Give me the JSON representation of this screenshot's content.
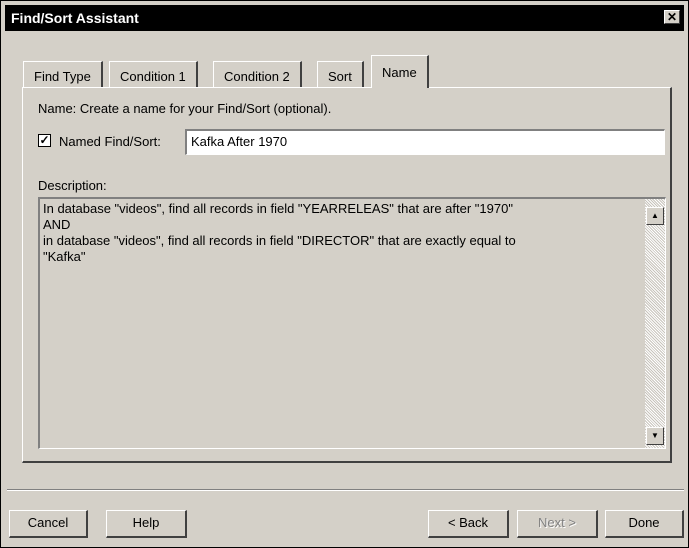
{
  "window": {
    "title": "Find/Sort Assistant",
    "close_glyph": "✕"
  },
  "tabs": [
    {
      "label": "Find Type"
    },
    {
      "label": "Condition 1"
    },
    {
      "label": "Condition 2"
    },
    {
      "label": "Sort"
    },
    {
      "label": "Name",
      "active": true
    }
  ],
  "name_panel": {
    "instruction": "Name: Create a name for your Find/Sort (optional).",
    "named_checkbox_checked": true,
    "checkbox_glyph": "✓",
    "named_label": "Named Find/Sort:",
    "named_value": "Kafka After 1970",
    "description_label": "Description:",
    "description_text": "In database \"videos\", find all records in field \"YEARRELEAS\" that are after \"1970\"\nAND\nin database \"videos\", find all records in field \"DIRECTOR\" that are exactly equal to\n\"Kafka\""
  },
  "buttons": {
    "cancel": "Cancel",
    "help": "Help",
    "back": "< Back",
    "next": "Next >",
    "done": "Done"
  },
  "scroll_icons": {
    "up": "▲",
    "down": "▼"
  }
}
